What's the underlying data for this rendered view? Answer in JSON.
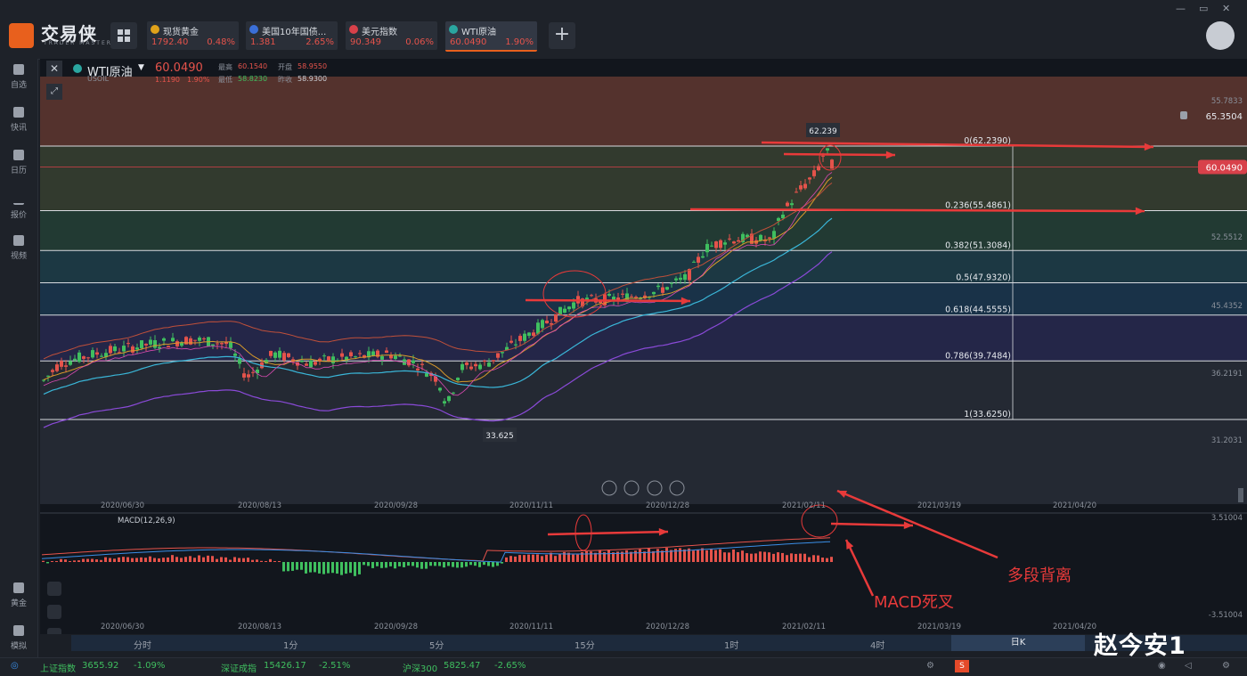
{
  "app": {
    "name": "交易侠",
    "subtitle": "TRADER MASTER"
  },
  "tickers": [
    {
      "name": "现货黄金",
      "price": "1792.40",
      "change": "0.48%",
      "icon_color": "#e0a21a"
    },
    {
      "name": "美国10年国债...",
      "price": "1.381",
      "change": "2.65%",
      "icon_color": "#3b6fd8"
    },
    {
      "name": "美元指数",
      "price": "90.349",
      "change": "0.06%",
      "icon_color": "#d8414a"
    },
    {
      "name": "WTI原油",
      "price": "60.0490",
      "change": "1.90%",
      "icon_color": "#2aa6a0"
    }
  ],
  "window_controls": [
    "—",
    "▭",
    "✕"
  ],
  "sidebar": [
    {
      "label": "自选",
      "icon": "bookmark-icon"
    },
    {
      "label": "快讯",
      "icon": "news-icon"
    },
    {
      "label": "日历",
      "icon": "calendar-icon"
    },
    {
      "label": "报价",
      "icon": "quote-icon"
    },
    {
      "label": "视频",
      "icon": "video-icon"
    },
    {
      "label": "黄金",
      "icon": "gold-icon"
    },
    {
      "label": "模拟",
      "icon": "simulate-icon"
    }
  ],
  "instrument": {
    "name": "WTI原油",
    "code": "USOIL",
    "price": "60.0490",
    "change": "1.1190",
    "change_pct": "1.90%",
    "high_label": "最高",
    "high": "60.1540",
    "open_label": "开盘",
    "open": "58.9550",
    "low_label": "最低",
    "low": "58.8230",
    "prev_label": "昨收",
    "prev": "58.9300"
  },
  "price_axis": [
    "55.7833",
    "52.5512",
    "45.4352",
    "36.2191",
    "31.2031"
  ],
  "alert_price": "65.3504",
  "current_price_tag": "60.0490",
  "fib_levels": [
    {
      "label": "0(62.2390)",
      "color": "#8a4a3a"
    },
    {
      "label": "0.236(55.4861)",
      "color": "#4d5a3c"
    },
    {
      "label": "0.382(51.3084)",
      "color": "#2f5a45"
    },
    {
      "label": "0.5(47.9320)",
      "color": "#245563"
    },
    {
      "label": "0.618(44.5555)",
      "color": "#1f4a6b"
    },
    {
      "label": "0.786(39.7484)",
      "color": "#33356b"
    },
    {
      "label": "1(33.6250)",
      "color": "#333a46"
    }
  ],
  "high_marker": "62.239",
  "low_marker": "33.625",
  "date_labels": [
    "2020/06/30",
    "2020/08/13",
    "2020/09/28",
    "2020/11/11",
    "2020/12/28",
    "2021/02/11",
    "2021/03/19",
    "2021/04/20"
  ],
  "macd_label": "MACD(12,26,9)",
  "macd_axis": [
    "3.51004",
    "-3.51004"
  ],
  "annotations": {
    "divergence": "多段背离",
    "death_cross": "MACD死叉"
  },
  "timeframes": [
    "分时",
    "1分",
    "5分",
    "15分",
    "1时",
    "4时",
    "日K"
  ],
  "active_timeframe": "日K",
  "indices": [
    {
      "name": "上证指数",
      "value": "3655.92",
      "change": "-1.09%"
    },
    {
      "name": "深证成指",
      "value": "15426.17",
      "change": "-2.51%"
    },
    {
      "name": "沪深300",
      "value": "5825.47",
      "change": "-2.65%"
    }
  ],
  "watermark": "赵今安1"
}
